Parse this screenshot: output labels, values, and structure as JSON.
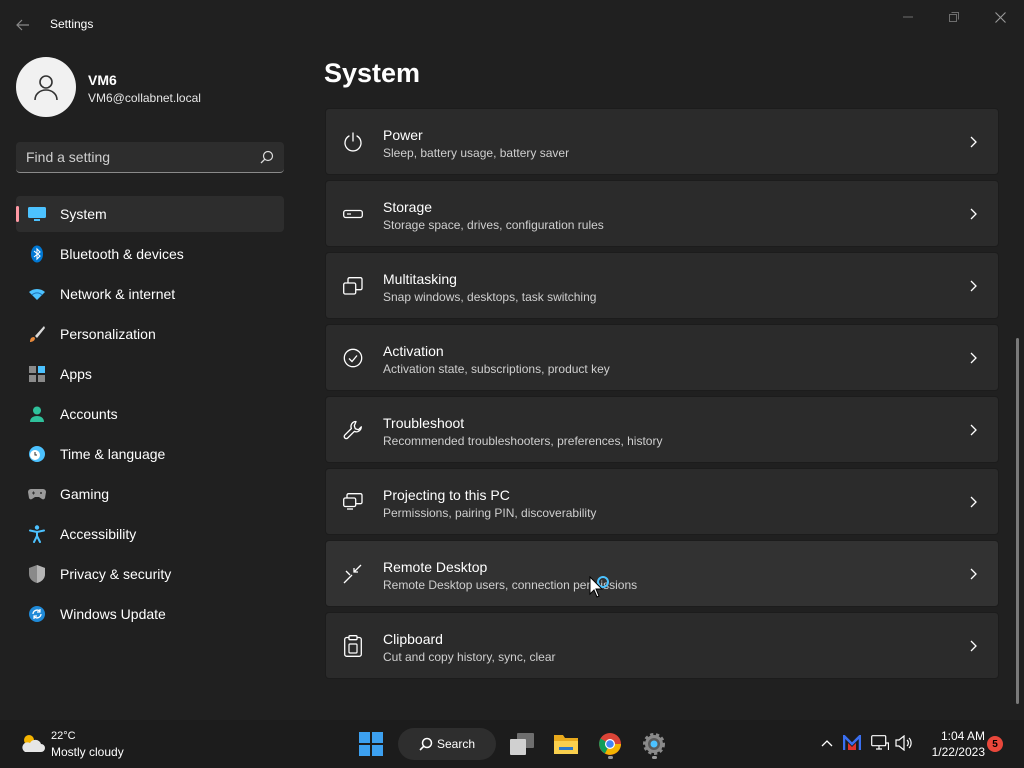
{
  "window": {
    "title": "Settings"
  },
  "profile": {
    "name": "VM6",
    "email": "VM6@collabnet.local"
  },
  "search": {
    "placeholder": "Find a setting"
  },
  "nav": {
    "items": [
      {
        "label": "System",
        "icon": "monitor-icon",
        "active": true
      },
      {
        "label": "Bluetooth & devices",
        "icon": "bluetooth-icon"
      },
      {
        "label": "Network & internet",
        "icon": "wifi-icon"
      },
      {
        "label": "Personalization",
        "icon": "brush-icon"
      },
      {
        "label": "Apps",
        "icon": "apps-icon"
      },
      {
        "label": "Accounts",
        "icon": "person-icon"
      },
      {
        "label": "Time & language",
        "icon": "clock-globe-icon"
      },
      {
        "label": "Gaming",
        "icon": "gamepad-icon"
      },
      {
        "label": "Accessibility",
        "icon": "accessibility-icon"
      },
      {
        "label": "Privacy & security",
        "icon": "shield-icon"
      },
      {
        "label": "Windows Update",
        "icon": "update-icon"
      }
    ]
  },
  "main": {
    "title": "System",
    "cards": [
      {
        "title": "Power",
        "desc": "Sleep, battery usage, battery saver",
        "icon": "power-icon"
      },
      {
        "title": "Storage",
        "desc": "Storage space, drives, configuration rules",
        "icon": "storage-icon"
      },
      {
        "title": "Multitasking",
        "desc": "Snap windows, desktops, task switching",
        "icon": "multitasking-icon"
      },
      {
        "title": "Activation",
        "desc": "Activation state, subscriptions, product key",
        "icon": "check-circle-icon"
      },
      {
        "title": "Troubleshoot",
        "desc": "Recommended troubleshooters, preferences, history",
        "icon": "wrench-icon"
      },
      {
        "title": "Projecting to this PC",
        "desc": "Permissions, pairing PIN, discoverability",
        "icon": "projecting-icon"
      },
      {
        "title": "Remote Desktop",
        "desc": "Remote Desktop users, connection permissions",
        "icon": "remote-desktop-icon",
        "hover": true
      },
      {
        "title": "Clipboard",
        "desc": "Cut and copy history, sync, clear",
        "icon": "clipboard-icon"
      }
    ]
  },
  "taskbar": {
    "weather": {
      "temp": "22°C",
      "desc": "Mostly cloudy"
    },
    "search_label": "Search",
    "clock": {
      "time": "1:04 AM",
      "date": "1/22/2023"
    },
    "notification_count": "5"
  },
  "colors": {
    "background": "#202020",
    "card": "#2b2b2b",
    "accent_indicator": "#ff99a4",
    "accent_blue": "#4cc2ff"
  }
}
